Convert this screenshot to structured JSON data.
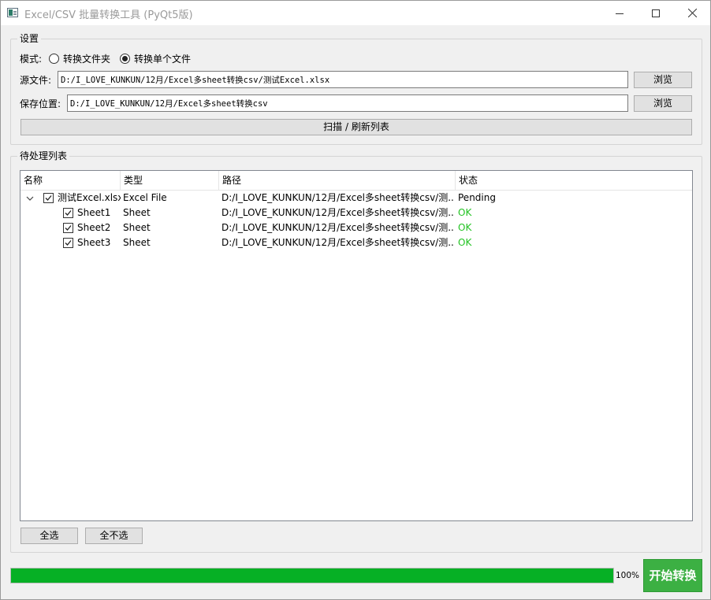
{
  "window": {
    "title": "Excel/CSV 批量转换工具 (PyQt5版)"
  },
  "settings": {
    "group_title": "设置",
    "mode_label": "模式:",
    "mode_options": [
      {
        "label": "转换文件夹",
        "checked": false
      },
      {
        "label": "转换单个文件",
        "checked": true
      }
    ],
    "source_label": "源文件:",
    "source_value": "D:/I_LOVE_KUNKUN/12月/Excel多sheet转换csv/测试Excel.xlsx",
    "save_label": "保存位置:",
    "save_value": "D:/I_LOVE_KUNKUN/12月/Excel多sheet转换csv",
    "browse_label": "浏览",
    "scan_label": "扫描 / 刷新列表"
  },
  "list": {
    "group_title": "待处理列表",
    "columns": [
      "名称",
      "类型",
      "路径",
      "状态"
    ],
    "rows": [
      {
        "name": "测试Excel.xlsx",
        "type": "Excel File",
        "path": "D:/I_LOVE_KUNKUN/12月/Excel多sheet转换csv/测...",
        "status": "Pending",
        "checked": true,
        "level": 0
      },
      {
        "name": "Sheet1",
        "type": "Sheet",
        "path": "D:/I_LOVE_KUNKUN/12月/Excel多sheet转换csv/测...",
        "status": "OK",
        "checked": true,
        "level": 1
      },
      {
        "name": "Sheet2",
        "type": "Sheet",
        "path": "D:/I_LOVE_KUNKUN/12月/Excel多sheet转换csv/测...",
        "status": "OK",
        "checked": true,
        "level": 1
      },
      {
        "name": "Sheet3",
        "type": "Sheet",
        "path": "D:/I_LOVE_KUNKUN/12月/Excel多sheet转换csv/测...",
        "status": "OK",
        "checked": true,
        "level": 1
      }
    ],
    "select_all_label": "全选",
    "select_none_label": "全不选"
  },
  "progress": {
    "value_percent": 100,
    "text": "100%"
  },
  "start_button_label": "开始转换",
  "colors": {
    "status_ok": "#22c322",
    "progress_fill": "#06b025",
    "start_button": "#3cb043"
  }
}
